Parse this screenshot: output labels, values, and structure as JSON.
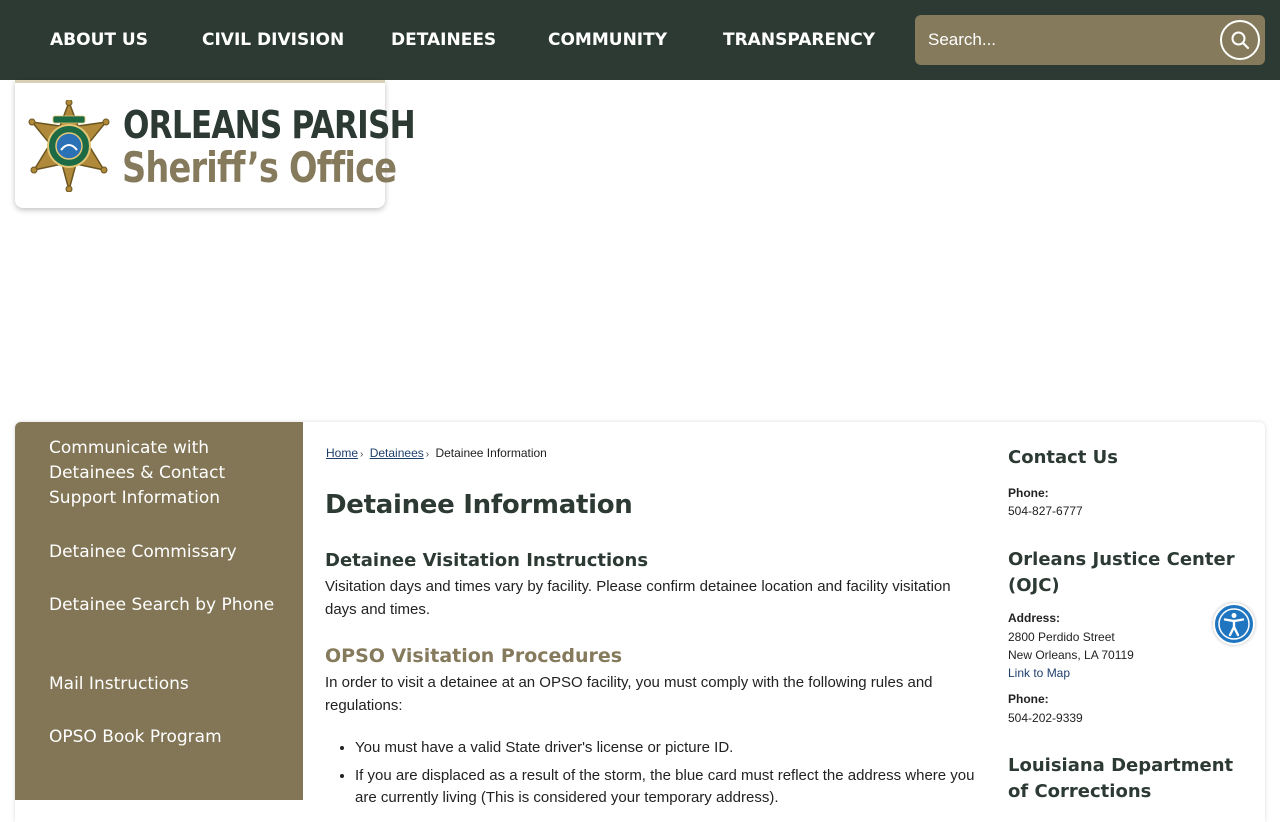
{
  "nav": {
    "items": [
      {
        "label": "ABOUT US"
      },
      {
        "label": "CIVIL DIVISION"
      },
      {
        "label": "DETAINEES"
      },
      {
        "label": "COMMUNITY"
      },
      {
        "label": "TRANSPARENCY"
      }
    ],
    "search_placeholder": "Search..."
  },
  "logo": {
    "line1": "ORLEANS PARISH",
    "line2": "Sheriff’s Office"
  },
  "sidebar": {
    "items": [
      {
        "label": "Communicate with Detainees & Contact Support Information"
      },
      {
        "label": "Detainee Commissary"
      },
      {
        "label": "Detainee Search by Phone"
      },
      {
        "label": "Mail Instructions"
      },
      {
        "label": "OPSO Book Program"
      }
    ]
  },
  "breadcrumb": {
    "home": "Home",
    "detainees": " Detainees",
    "current": "Detainee Information"
  },
  "content": {
    "title": "Detainee Information",
    "section1_heading": "Detainee Visitation Instructions",
    "section1_text": "Visitation days and times vary by facility. Please confirm detainee location and facility visitation days and times.",
    "section2_heading": "OPSO Visitation Procedures",
    "section2_text": "In order to visit a detainee at an OPSO facility, you must comply with the following rules and regulations:",
    "bullets": [
      "You must have a valid State driver's license or picture ID.",
      "If you are displaced as a result of the storm, the blue card must reflect the address where you are currently living (This is considered your temporary address)."
    ]
  },
  "contact": {
    "heading": "Contact Us",
    "phone_label": "Phone:",
    "phone": "504-827-6777",
    "ojc_heading": "Orleans Justice Center (OJC)",
    "address_label": "Address:",
    "address_line1": "2800 Perdido Street",
    "address_line2": "New Orleans, LA 70119",
    "map_link": "Link to Map",
    "ojc_phone_label": "Phone:",
    "ojc_phone": "504-202-9339",
    "ldoc_heading": "Louisiana Department of Corrections"
  },
  "colors": {
    "nav_bg": "#2c3a33",
    "accent_gold": "#857a5b",
    "sidebar_bg": "#827656",
    "link": "#1f3f6b",
    "accessibility_blue": "#1f75bf"
  }
}
